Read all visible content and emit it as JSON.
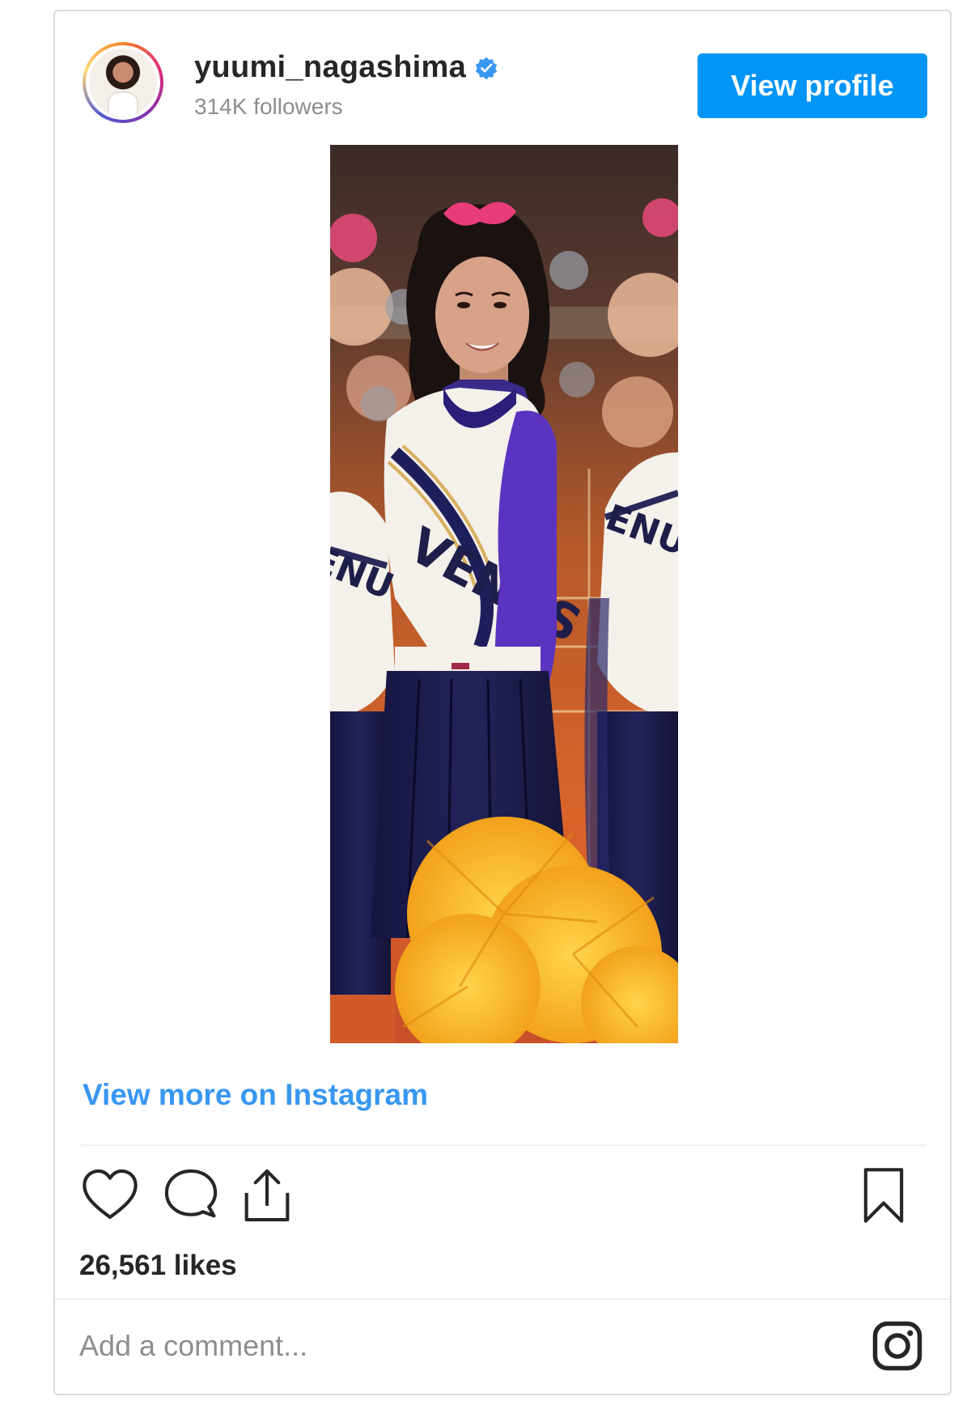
{
  "profile": {
    "username": "yuumi_nagashima",
    "followers": "314K followers",
    "view_profile_label": "View profile"
  },
  "post": {
    "view_more_label": "View more on Instagram",
    "likes": "26,561 likes",
    "comment_placeholder": "Add a comment...",
    "jersey_text": "VENUS"
  },
  "icons": {
    "verified": "verified-badge-icon",
    "like": "heart-icon",
    "comment": "speech-bubble-icon",
    "share": "share-upload-icon",
    "save": "bookmark-icon",
    "logo": "instagram-icon"
  },
  "colors": {
    "accent": "#0095f6",
    "link": "#3897f0",
    "verified": "#3897f0",
    "text": "#262626",
    "muted": "#8e8e8e"
  }
}
